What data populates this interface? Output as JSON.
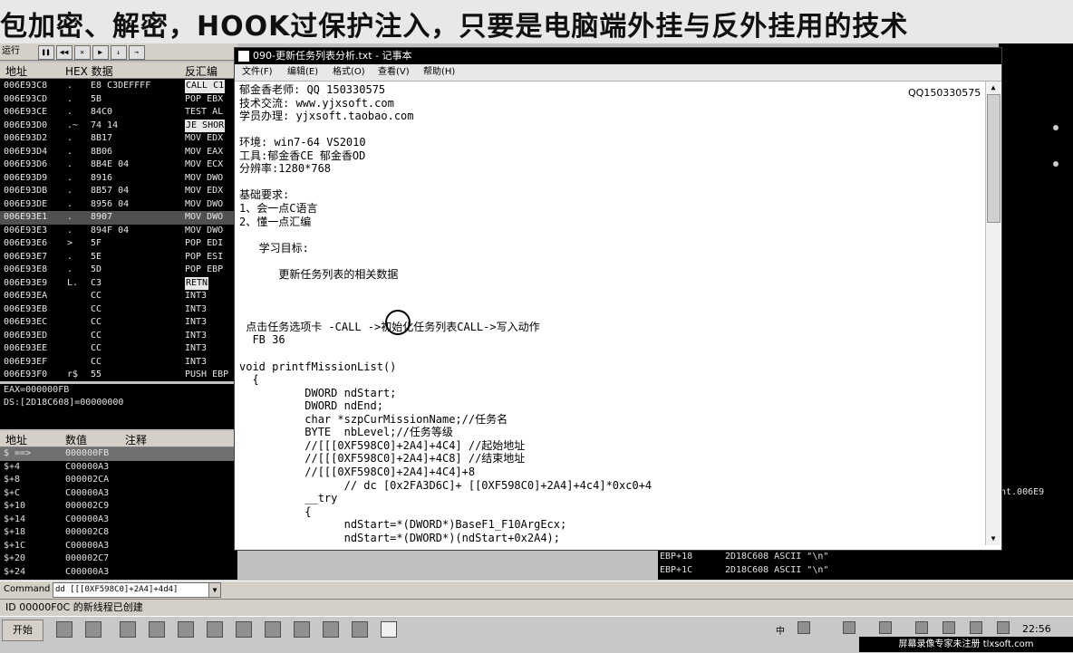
{
  "banner": {
    "text": "包加密、解密，HOOK过保护注入，只要是电脑端外挂与反外挂用的技术"
  },
  "od": {
    "status_run": "运行",
    "toolbar_icons": [
      "pause-icon",
      "restart-icon",
      "close-icon",
      "run-icon",
      "step-into-icon",
      "step-over-icon"
    ],
    "disasm_headers": {
      "addr": "地址",
      "hex": "HEX 数据",
      "disasm": "反汇编"
    },
    "disasm_rows": [
      {
        "addr": "006E93C8",
        "mark": ".",
        "hex": "E8 C3DEFFFF",
        "op": "CALL C1"
      },
      {
        "addr": "006E93CD",
        "mark": ".",
        "hex": "5B",
        "op": "POP EBX"
      },
      {
        "addr": "006E93CE",
        "mark": ".",
        "hex": "84C0",
        "op": "TEST AL"
      },
      {
        "addr": "006E93D0",
        "mark": ".~",
        "hex": "74 14",
        "op": "JE SHOR"
      },
      {
        "addr": "006E93D2",
        "mark": ".",
        "hex": "8B17",
        "op": "MOV EDX"
      },
      {
        "addr": "006E93D4",
        "mark": ".",
        "hex": "8B06",
        "op": "MOV EAX"
      },
      {
        "addr": "006E93D6",
        "mark": ".",
        "hex": "8B4E 04",
        "op": "MOV ECX"
      },
      {
        "addr": "006E93D9",
        "mark": ".",
        "hex": "8916",
        "op": "MOV DWO"
      },
      {
        "addr": "006E93DB",
        "mark": ".",
        "hex": "8B57 04",
        "op": "MOV EDX"
      },
      {
        "addr": "006E93DE",
        "mark": ".",
        "hex": "8956 04",
        "op": "MOV DWO"
      },
      {
        "addr": "006E93E1",
        "mark": ".",
        "hex": "8907",
        "op": "MOV DWO"
      },
      {
        "addr": "006E93E3",
        "mark": ".",
        "hex": "894F 04",
        "op": "MOV DWO"
      },
      {
        "addr": "006E93E6",
        "mark": ">",
        "hex": "5F",
        "op": "POP EDI"
      },
      {
        "addr": "006E93E7",
        "mark": ".",
        "hex": "5E",
        "op": "POP ESI"
      },
      {
        "addr": "006E93E8",
        "mark": ".",
        "hex": "5D",
        "op": "POP EBP"
      },
      {
        "addr": "006E93E9",
        "mark": "L.",
        "hex": "C3",
        "op": "RETN"
      },
      {
        "addr": "006E93EA",
        "mark": "",
        "hex": "CC",
        "op": "INT3"
      },
      {
        "addr": "006E93EB",
        "mark": "",
        "hex": "CC",
        "op": "INT3"
      },
      {
        "addr": "006E93EC",
        "mark": "",
        "hex": "CC",
        "op": "INT3"
      },
      {
        "addr": "006E93ED",
        "mark": "",
        "hex": "CC",
        "op": "INT3"
      },
      {
        "addr": "006E93EE",
        "mark": "",
        "hex": "CC",
        "op": "INT3"
      },
      {
        "addr": "006E93EF",
        "mark": "",
        "hex": "CC",
        "op": "INT3"
      },
      {
        "addr": "006E93F0",
        "mark": "r$",
        "hex": "55",
        "op": "PUSH EBP"
      }
    ],
    "reg_info": [
      "EAX=000000FB",
      "DS:[2D18C608]=00000000"
    ],
    "stack_headers": {
      "addr": "地址",
      "value": "数值",
      "comment": "注释"
    },
    "stack_rows": [
      {
        "addr": "$ ==>",
        "value": "000000FB"
      },
      {
        "addr": "$+4",
        "value": "C00000A3"
      },
      {
        "addr": "$+8",
        "value": "000002CA"
      },
      {
        "addr": "$+C",
        "value": "C00000A3"
      },
      {
        "addr": "$+10",
        "value": "000002C9"
      },
      {
        "addr": "$+14",
        "value": "C00000A3"
      },
      {
        "addr": "$+18",
        "value": "000002C8"
      },
      {
        "addr": "$+1C",
        "value": "C00000A3"
      },
      {
        "addr": "$+20",
        "value": "000002C7"
      },
      {
        "addr": "$+24",
        "value": "C00000A3"
      }
    ],
    "right_bottom_rows": [
      {
        "reg": "EBP+18",
        "val": "2D18C608 ASCII \"\\n\""
      },
      {
        "reg": "EBP+1C",
        "val": "2D18C608 ASCII \"\\n\""
      }
    ],
    "right_partial": "nt.006E9",
    "command_label": "Command",
    "command_value": "dd [[[0XF598C0]+2A4]+4d4]",
    "status_text": "ID 00000F0C 的新线程已创建"
  },
  "notepad": {
    "title": "090-更新任务列表分析.txt - 记事本",
    "menus": [
      "文件(F)",
      "编辑(E)",
      "格式(O)",
      "查看(V)",
      "帮助(H)"
    ],
    "qq_watermark": "QQ150330575",
    "lines": [
      "郁金香老师: QQ 150330575",
      "技术交流: www.yjxsoft.com",
      "学员办理: yjxsoft.taobao.com",
      "",
      "环境: win7-64 VS2010",
      "工具:郁金香CE 郁金香OD",
      "分辨率:1280*768",
      "",
      "基础要求:",
      "1、会一点C语言",
      "2、懂一点汇编",
      "",
      "   学习目标:",
      "",
      "      更新任务列表的相关数据",
      "",
      "",
      "",
      " 点击任务选项卡 -CALL ->初始化任务列表CALL->写入动作",
      "  FB 36",
      "",
      "void printfMissionList()",
      "  {",
      "          DWORD ndStart;",
      "          DWORD ndEnd;",
      "          char *szpCurMissionName;//任务名",
      "          BYTE  nbLevel;//任务等级",
      "          //[[[0XF598C0]+2A4]+4C4] //起始地址",
      "          //[[[0XF598C0]+2A4]+4C8] //结束地址",
      "          //[[[0XF598C0]+2A4]+4C4]+8",
      "                // dc [0x2FA3D6C]+ [[0XF598C0]+2A4]+4c4]*0xc0+4",
      "          __try",
      "          {",
      "                ndStart=*(DWORD*)BaseF1_F10ArgEcx;",
      "                ndStart=*(DWORD*)(ndStart+0x2A4);"
    ]
  },
  "taskbar": {
    "start_label": "开始",
    "ime_text": "中",
    "clock": "22:56",
    "footer_watermark": "屏幕录像专家未注册 tlxsoft.com"
  },
  "colors": {
    "od_bg": "#000000",
    "chrome": "#d4d0c8",
    "notepad_bg": "#ffffff",
    "title_bg": "#000000"
  }
}
